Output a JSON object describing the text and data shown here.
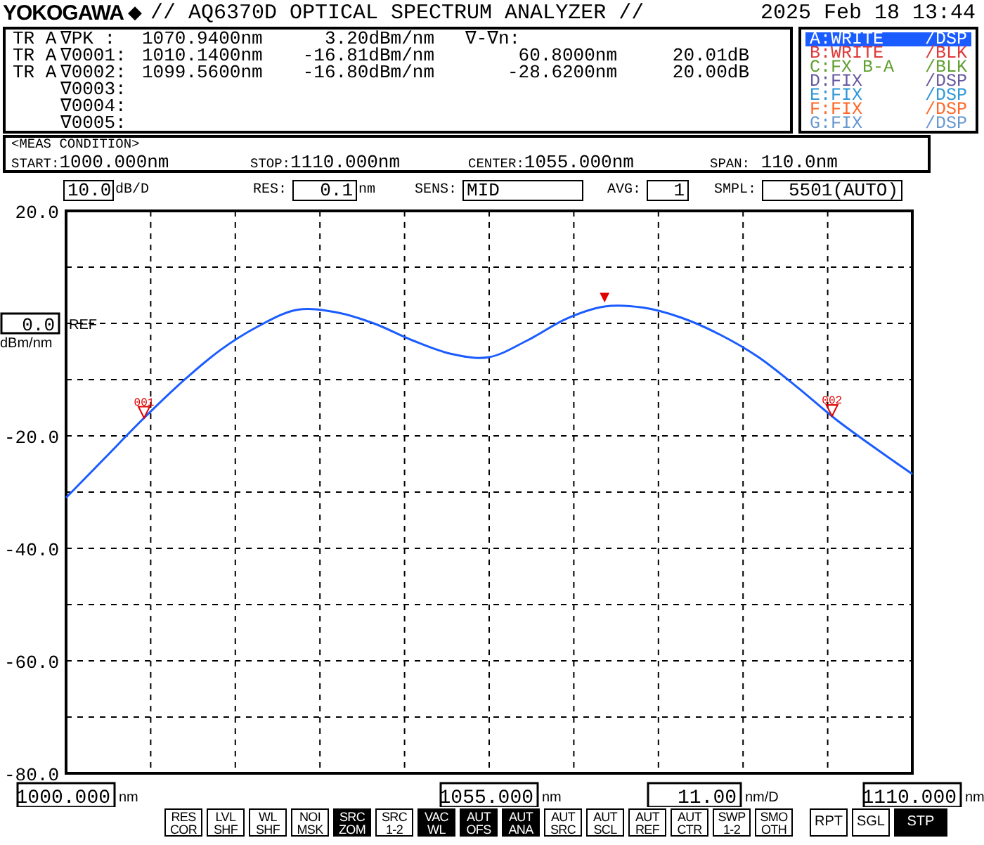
{
  "header": {
    "brand": "YOKOGAWA",
    "logo_mark": "◆",
    "model_title": "// AQ6370D OPTICAL SPECTRUM ANALYZER //",
    "datetime": "2025 Feb 18 13:44"
  },
  "markers": {
    "delta_header": "∇-∇n:",
    "rows": [
      {
        "trace": "TR A",
        "name": "∇PK :",
        "wavelength": "1070.9400nm",
        "power": "3.20dBm/nm"
      },
      {
        "trace": "TR A",
        "name": "∇0001:",
        "wavelength": "1010.1400nm",
        "power": "-16.81dBm/nm",
        "delta_wl": "60.8000nm",
        "delta_db": "20.01dB"
      },
      {
        "trace": "TR A",
        "name": "∇0002:",
        "wavelength": "1099.5600nm",
        "power": "-16.80dBm/nm",
        "delta_wl": "-28.6200nm",
        "delta_db": "20.00dB"
      },
      {
        "name": "∇0003:"
      },
      {
        "name": "∇0004:"
      },
      {
        "name": "∇0005:"
      }
    ]
  },
  "traces": [
    {
      "label": "A:WRITE",
      "mode": "/DSP",
      "color": "#1a5cff",
      "selected": true
    },
    {
      "label": "B:WRITE",
      "mode": "/BLK",
      "color": "#e03838",
      "selected": false
    },
    {
      "label": "C:FX B-A",
      "mode": "/BLK",
      "color": "#60a030",
      "selected": false
    },
    {
      "label": "D:FIX",
      "mode": "/DSP",
      "color": "#6a5aa0",
      "selected": false
    },
    {
      "label": "E:FIX",
      "mode": "/DSP",
      "color": "#3098d8",
      "selected": false
    },
    {
      "label": "F:FIX",
      "mode": "/DSP",
      "color": "#ff6828",
      "selected": false
    },
    {
      "label": "G:FIX",
      "mode": "/DSP",
      "color": "#6898d0",
      "selected": false
    }
  ],
  "meas_condition": {
    "title": "<MEAS CONDITION>",
    "items": [
      {
        "label": "START:",
        "value": "1000.000nm"
      },
      {
        "label": "STOP:",
        "value": "1110.000nm"
      },
      {
        "label": "CENTER:",
        "value": "1055.000nm"
      },
      {
        "label": "SPAN:",
        "value": " 110.0nm"
      }
    ]
  },
  "settings": [
    {
      "value": "10.0",
      "unit": "dB/D"
    },
    {
      "label": "RES:",
      "value": "0.1",
      "unit": "nm"
    },
    {
      "label": "SENS:",
      "value": "MID"
    },
    {
      "label": "AVG:",
      "value": "1"
    },
    {
      "label": "SMPL:",
      "value": "5501(AUTO)"
    }
  ],
  "ref": {
    "value": "0.0",
    "label": "REF",
    "unit": "dBm/nm"
  },
  "chart_data": {
    "type": "line",
    "xlim": [
      1000,
      1110
    ],
    "ylim": [
      -80,
      20
    ],
    "xticks": [
      {
        "value": 1000,
        "label": "1000.000"
      },
      {
        "value": 1055,
        "label": "1055.000"
      },
      {
        "value": 1110,
        "label": "1110.000"
      }
    ],
    "yticks": [
      {
        "value": 20,
        "label": "20.0"
      },
      {
        "value": -20,
        "label": "-20.0"
      },
      {
        "value": -40,
        "label": "-40.0"
      },
      {
        "value": -60,
        "label": "-60.0"
      },
      {
        "value": -80,
        "label": "-80.0"
      }
    ],
    "x": [
      1000,
      1005,
      1010,
      1015,
      1020,
      1025,
      1030,
      1035,
      1040,
      1045,
      1050,
      1055,
      1060,
      1065,
      1070,
      1075,
      1080,
      1085,
      1090,
      1095,
      1100,
      1105,
      1110
    ],
    "grid": true,
    "series": [
      {
        "color": "#1a5cff",
        "values": [
          -31,
          -24,
          -17,
          -10.5,
          -4.8,
          -0.5,
          2.4,
          2.0,
          0,
          -3,
          -5.4,
          -6.0,
          -3.0,
          0.8,
          3.0,
          2.8,
          1.0,
          -2.0,
          -6.0,
          -11.3,
          -17,
          -22,
          -26.8
        ]
      }
    ],
    "annotations": [
      "001",
      "002"
    ]
  },
  "peak_marker": {
    "symbol": "▼"
  },
  "x_scale": {
    "tick_units": [
      "nm",
      "nm",
      "nm"
    ],
    "division": {
      "value": "11.00",
      "unit": "nm/D"
    }
  },
  "soft_keys": [
    {
      "lines": [
        "RES",
        "COR"
      ],
      "on": false
    },
    {
      "lines": [
        "LVL",
        "SHF"
      ],
      "on": false
    },
    {
      "lines": [
        "WL",
        "SHF"
      ],
      "on": false
    },
    {
      "lines": [
        "NOI",
        "MSK"
      ],
      "on": false
    },
    {
      "lines": [
        "SRC",
        "ZOM"
      ],
      "on": true
    },
    {
      "lines": [
        "SRC",
        "1-2"
      ],
      "on": false
    },
    {
      "lines": [
        "VAC",
        "WL"
      ],
      "on": true
    },
    {
      "lines": [
        "AUT",
        "OFS"
      ],
      "on": true
    },
    {
      "lines": [
        "AUT",
        "ANA"
      ],
      "on": true
    },
    {
      "lines": [
        "AUT",
        "SRC"
      ],
      "on": false
    },
    {
      "lines": [
        "AUT",
        "SCL"
      ],
      "on": false
    },
    {
      "lines": [
        "AUT",
        "REF"
      ],
      "on": false
    },
    {
      "lines": [
        "AUT",
        "CTR"
      ],
      "on": false
    },
    {
      "lines": [
        "SWP",
        "1-2"
      ],
      "on": false
    },
    {
      "lines": [
        "SMO",
        "OTH"
      ],
      "on": false
    }
  ],
  "sweep_keys": [
    {
      "label": "RPT",
      "on": false
    },
    {
      "label": "SGL",
      "on": false
    },
    {
      "label": "STP",
      "on": true
    }
  ]
}
